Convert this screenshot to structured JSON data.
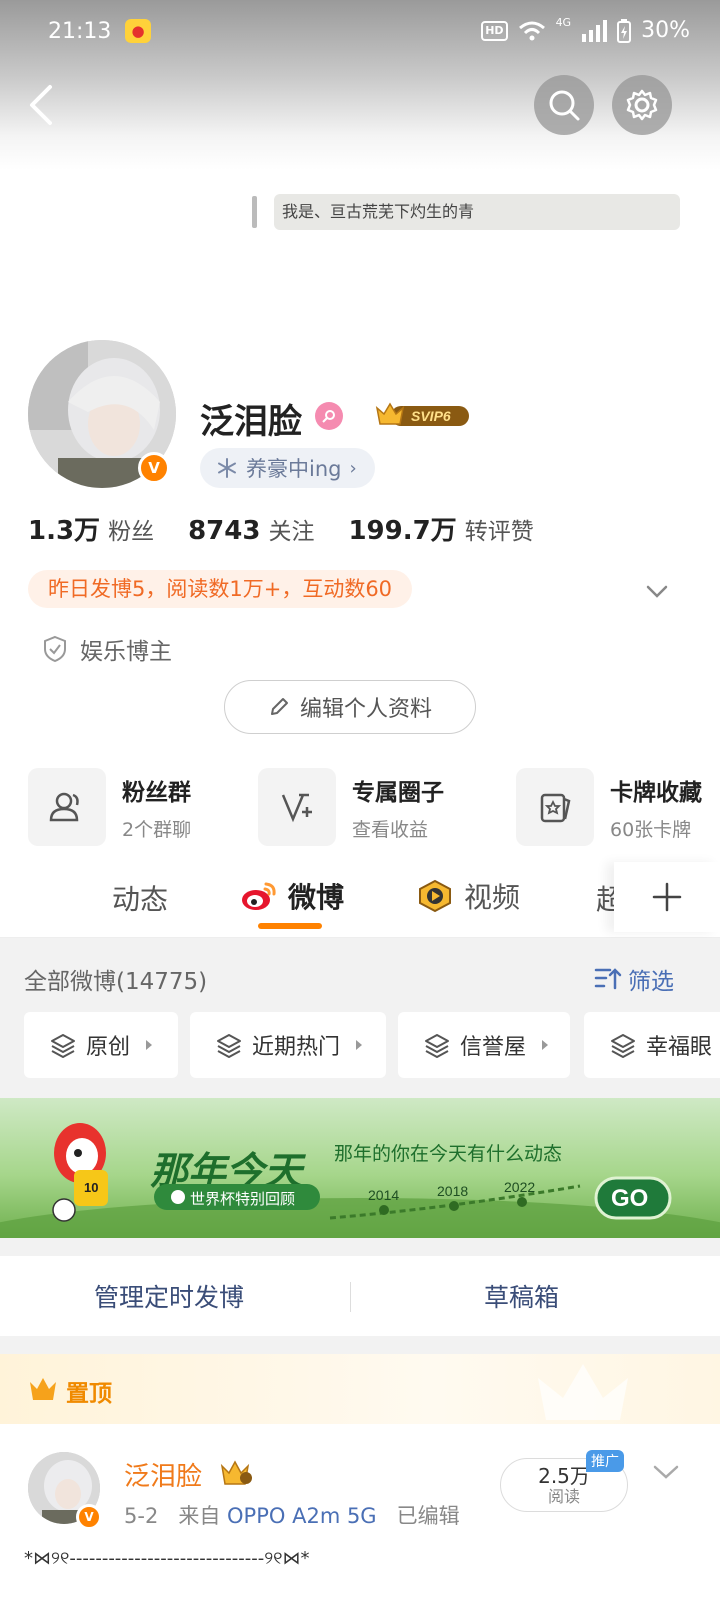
{
  "status_bar": {
    "time": "21:13",
    "app_icon": "weibo-icon",
    "hd": "HD",
    "network": "4G",
    "battery": "30%"
  },
  "header": {
    "back_icon": "back-arrow-icon",
    "search_icon": "search-icon",
    "settings_icon": "gear-icon"
  },
  "bubble": {
    "text": "我是、亘古荒芜下灼生的青"
  },
  "profile": {
    "name": "泛泪脸",
    "gender_icon": "female-icon",
    "vip_badge": "SVIP6",
    "verified": "V",
    "tag": "养豪中ing",
    "stats": [
      {
        "num": "1.3万",
        "label": "粉丝"
      },
      {
        "num": "8743",
        "label": "关注"
      },
      {
        "num": "199.7万",
        "label": "转评赞"
      }
    ],
    "yesterday": "昨日发博5，阅读数1万+，互动数60",
    "category": "娱乐博主",
    "edit_button": "编辑个人资料"
  },
  "functions": [
    {
      "title": "粉丝群",
      "sub": "2个群聊",
      "icon": "fans-group-icon"
    },
    {
      "title": "专属圈子",
      "sub": "查看收益",
      "icon": "circle-icon"
    },
    {
      "title": "卡牌收藏",
      "sub": "60张卡牌",
      "icon": "card-icon"
    }
  ],
  "tabs": [
    {
      "label": "动态"
    },
    {
      "label": "微博"
    },
    {
      "label": "视频"
    },
    {
      "label": "超"
    }
  ],
  "weibo_list": {
    "all_count": "全部微博(14775)",
    "filter_label": "筛选",
    "chips": [
      "原创",
      "近期热门",
      "信誉屋",
      "幸福眼"
    ]
  },
  "banner": {
    "title": "那年今天",
    "subtitle": "那年的你在今天有什么动态",
    "tag": "世界杯特别回顾",
    "years": [
      "2014",
      "2018",
      "2022"
    ],
    "go": "GO",
    "mascot_number": "10"
  },
  "manage": {
    "scheduled": "管理定时发博",
    "drafts": "草稿箱"
  },
  "pinned": {
    "label": "置顶"
  },
  "post": {
    "author": "泛泪脸",
    "date": "5-2",
    "from_label": "来自",
    "device": "OPPO A2m 5G",
    "edited": "已编辑",
    "reads_num": "2.5万",
    "reads_label": "阅读",
    "promo": "推广",
    "text": "*⋈୨୧‐‐‐‐‐‐‐‐‐‐‐‐‐‐‐‐‐‐‐‐‐‐‐‐‐‐‐‐‐‐୨୧⋈*"
  }
}
